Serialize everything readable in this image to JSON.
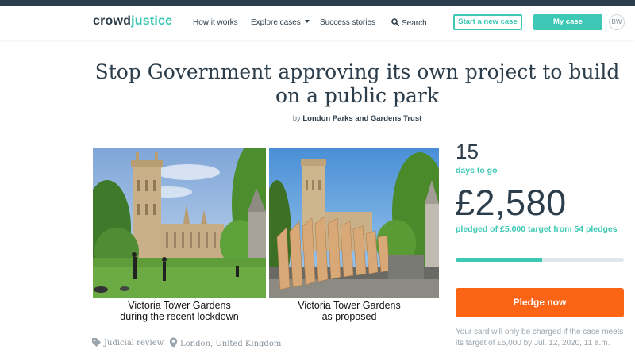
{
  "header": {
    "logo": {
      "part1": "crowd",
      "part2": "justice"
    },
    "nav": {
      "how_it_works": "How it works",
      "explore_cases": "Explore cases",
      "success_stories": "Success stories",
      "search": "Search"
    },
    "start_case_label": "Start a new case",
    "my_case_label": "My case",
    "avatar_initials": "BW",
    "icons": {
      "search": "search-icon",
      "explore": "chevron-down-icon"
    }
  },
  "case": {
    "title": "Stop Government approving its own project to build on a public park",
    "by_prefix": "by",
    "organiser": "London Parks and Gardens Trust",
    "image": {
      "caption_left_line1": "Victoria Tower Gardens",
      "caption_left_line2": "during the recent lockdown",
      "caption_right_line1": "Victoria Tower Gardens",
      "caption_right_line2": "as proposed"
    },
    "category": "Judicial review",
    "location": "London, United Kingdom"
  },
  "funding": {
    "days_left": "15",
    "days_label": "days to go",
    "amount": "£2,580",
    "pledged_text": "pledged of £5,000 target from 54 pledges",
    "progress_fraction": 0.516,
    "pledge_button": "Pledge now",
    "charge_note": "Your card will only be charged if the case meets its target of £5,000 by Jul. 12, 2020, 11 a.m."
  },
  "colors": {
    "accent": "#3cc8b4",
    "navy": "#2c3e4c",
    "pledge": "#fa6414"
  }
}
